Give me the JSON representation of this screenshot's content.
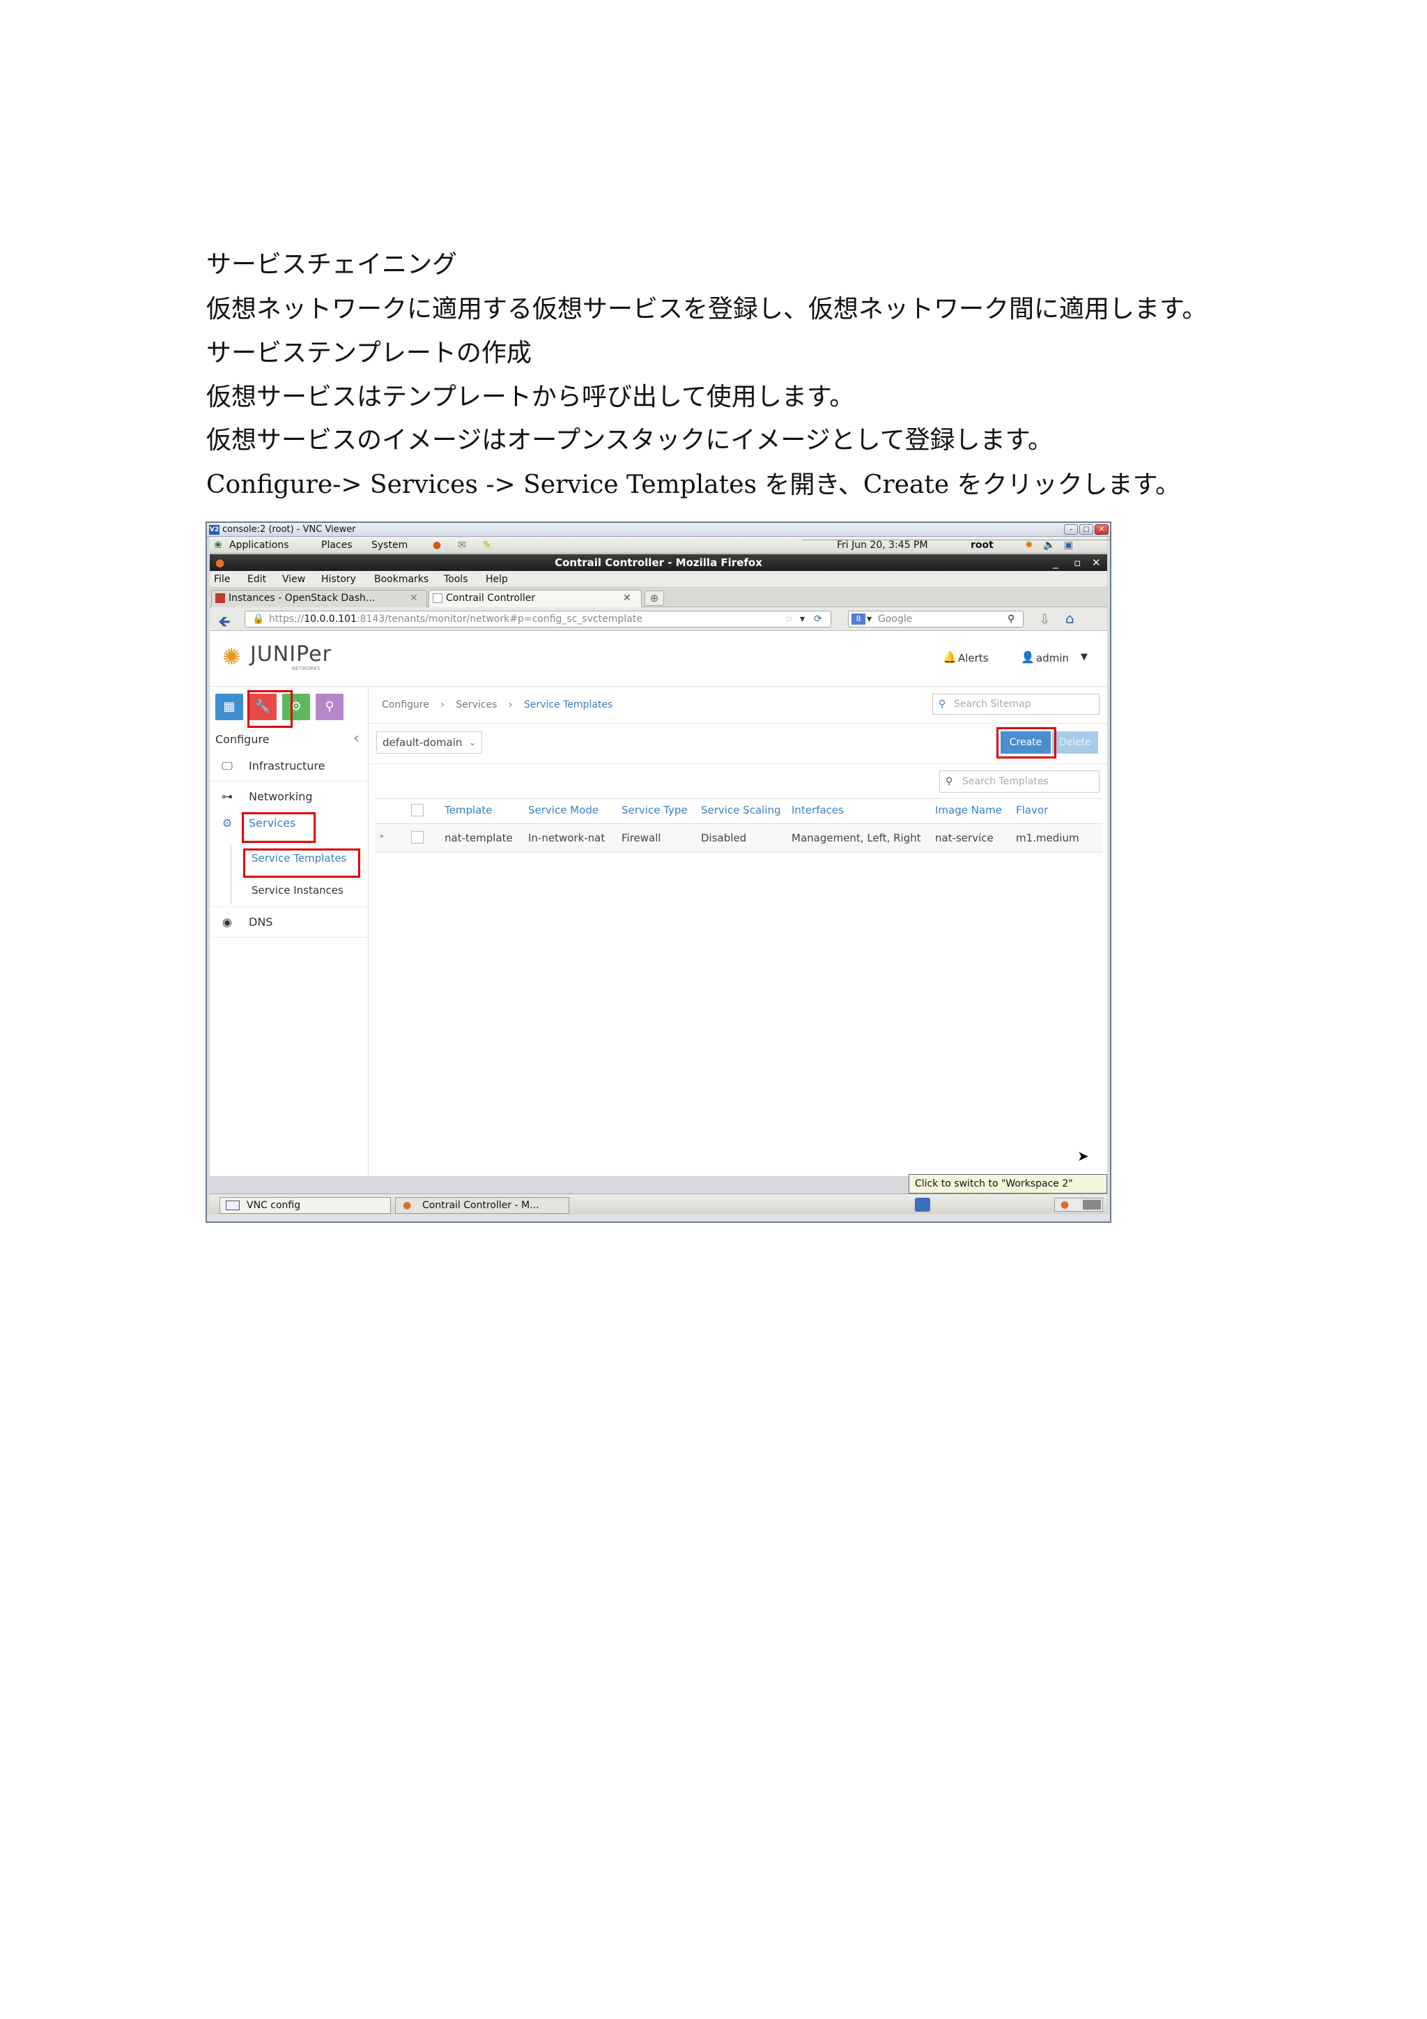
{
  "document": {
    "heading1": "サービスチェイニング",
    "para1": "仮想ネットワークに適用する仮想サービスを登録し、仮想ネットワーク間に適用します。",
    "heading2": "サービステンプレートの作成",
    "para2": "仮想サービスはテンプレートから呼び出して使用します。",
    "para3": "仮想サービスのイメージはオープンスタックにイメージとして登録します。",
    "para4": "Configure-> Services -> Service Templates  を開き、Create をクリックします。"
  },
  "vnc": {
    "title": "console:2 (root) - VNC Viewer",
    "logo": "V2"
  },
  "gnome_panel": {
    "menus": [
      "Applications",
      "Places",
      "System"
    ],
    "clock": "Fri Jun 20,  3:45 PM",
    "user": "root"
  },
  "firefox": {
    "title": "Contrail Controller - Mozilla Firefox",
    "menu": [
      "File",
      "Edit",
      "View",
      "History",
      "Bookmarks",
      "Tools",
      "Help"
    ],
    "tabs": [
      {
        "label": "Instances - OpenStack Dash..."
      },
      {
        "label": "Contrail Controller"
      }
    ],
    "url_prefix": "https://",
    "url_host": "10.0.0.101",
    "url_rest": ":8143/tenants/monitor/network#p=config_sc_svctemplate",
    "search_placeholder": "Google"
  },
  "app": {
    "logo_text": "JUNIPer",
    "logo_sub": "NETWORKS",
    "alerts_label": "Alerts",
    "user_label": "admin",
    "sidebar": {
      "section_label": "Configure",
      "items": [
        {
          "label": "Infrastructure"
        },
        {
          "label": "Networking"
        },
        {
          "label": "Services"
        },
        {
          "label": "DNS"
        }
      ],
      "subitems": [
        {
          "label": "Service Templates"
        },
        {
          "label": "Service Instances"
        }
      ]
    },
    "breadcrumb": [
      "Configure",
      "Services",
      "Service Templates"
    ],
    "sitemap_placeholder": "Search Sitemap",
    "domain_select": "default-domain",
    "create_label": "Create",
    "delete_label": "Delete",
    "template_search_placeholder": "Search Templates",
    "table": {
      "headers": [
        "Template",
        "Service Mode",
        "Service Type",
        "Service Scaling",
        "Interfaces",
        "Image Name",
        "Flavor"
      ],
      "rows": [
        [
          "nat-template",
          "In-network-nat",
          "Firewall",
          "Disabled",
          "Management, Left, Right",
          "nat-service",
          "m1.medium"
        ]
      ]
    }
  },
  "tooltip": "Click to switch to \"Workspace 2\"",
  "taskbar": {
    "items": [
      {
        "label": "VNC config"
      },
      {
        "label": "Contrail Controller - M..."
      }
    ]
  },
  "colors": {
    "highlight": "#e00000",
    "accent_blue": "#4a8ed0",
    "sidebar_monitor": "#3f8fd0",
    "sidebar_configure": "#e84a4a",
    "sidebar_settings": "#5cb85c",
    "sidebar_query": "#b786c8"
  }
}
